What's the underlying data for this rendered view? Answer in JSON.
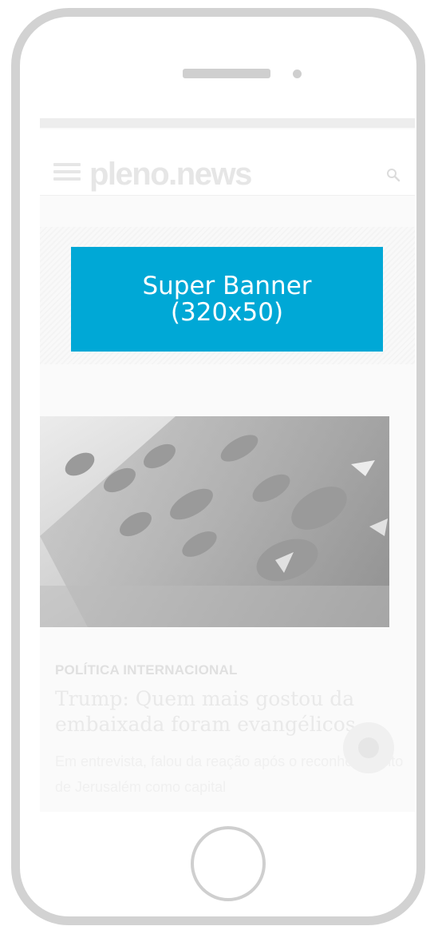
{
  "site": {
    "logo_text": "pleno.news"
  },
  "icons": {
    "menu": "hamburger-icon",
    "search": "search-icon",
    "fab": "circle-icon"
  },
  "ad": {
    "banner_text": "Super Banner\n(320x50)"
  },
  "article": {
    "category": "POLÍTICA INTERNACIONAL",
    "title": "Trump: Quem mais gostou da embaixada foram evangélicos",
    "excerpt": "Em entrevista, falou da reação após o reconhecimento de Jerusalém como capital"
  },
  "colors": {
    "banner": "#00a8d6",
    "phone_frame": "#d2d2d2"
  }
}
